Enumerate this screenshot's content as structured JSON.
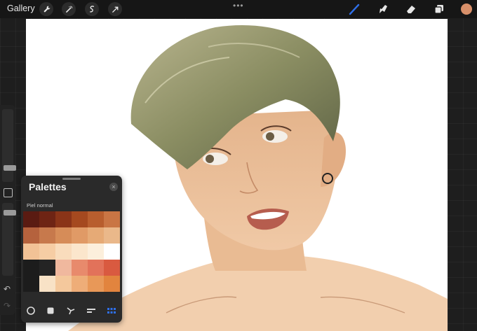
{
  "topbar": {
    "gallery_label": "Gallery",
    "tools_left": [
      "wrench-icon",
      "magic-wand-icon",
      "selection-icon",
      "transform-icon"
    ],
    "more_label": "•••",
    "tools_right": [
      "brush-icon",
      "smudge-icon",
      "eraser-icon",
      "layers-icon"
    ],
    "current_color": "#d8906a",
    "active_tool_color": "#2f6fe8"
  },
  "sidebar": {
    "undo_label": "↶",
    "redo_label": "↷"
  },
  "palettes": {
    "title": "Palettes",
    "close_label": "×",
    "palette_name": "Piel normal",
    "swatches": [
      "#5a1b12",
      "#6e2414",
      "#8a3418",
      "#a5491f",
      "#b85e2e",
      "#c97544",
      "#b5623d",
      "#c7794c",
      "#d68c58",
      "#e09a66",
      "#e6aa76",
      "#eab88a",
      "#f2c296",
      "#f6cda4",
      "#f9dcbc",
      "#fbe6cc",
      "#fcefdc",
      "#ffffff",
      "#1c1c1c",
      "#242424",
      "#f0b89e",
      "#e88a6c",
      "#e2725a",
      "#d95a40",
      "#1c1c1c",
      "#f8e2c6",
      "#f4c89c",
      "#eead78",
      "#e89858",
      "#e2843e"
    ],
    "tabs": [
      "disc-icon",
      "classic-icon",
      "harmony-icon",
      "value-icon",
      "palettes-icon"
    ],
    "active_tab_color": "#2f6fe8"
  }
}
